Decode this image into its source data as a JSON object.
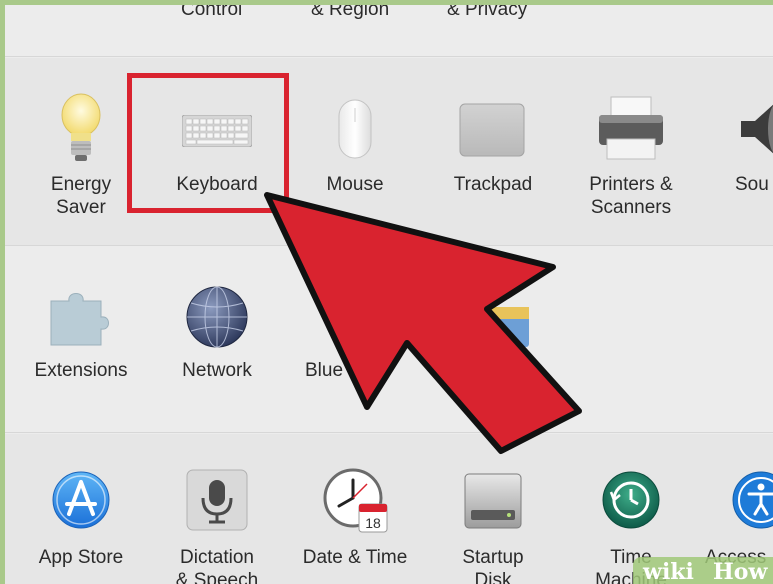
{
  "top_row": {
    "items": [
      "Control",
      "& Region",
      "& Privacy"
    ]
  },
  "row1": {
    "energy_saver": {
      "line1": "Energy",
      "line2": "Saver"
    },
    "keyboard": {
      "line1": "Keyboard"
    },
    "mouse": {
      "line1": "Mouse"
    },
    "trackpad": {
      "line1": "Trackpad"
    },
    "printers": {
      "line1": "Printers &",
      "line2": "Scanners"
    },
    "sound": {
      "line1": "Sou"
    }
  },
  "row2": {
    "extensions": {
      "line1": "Extensions"
    },
    "network": {
      "line1": "Network"
    },
    "bluetooth": {
      "line1": "Blue"
    }
  },
  "row3": {
    "app_store": {
      "line1": "App Store"
    },
    "dictation": {
      "line1": "Dictation",
      "line2": "& Speech"
    },
    "date_time": {
      "line1": "Date & Time",
      "calendar_day": "18"
    },
    "startup_disk": {
      "line1": "Startup",
      "line2": "Disk"
    },
    "time_machine": {
      "line1": "Time",
      "line2": "Machine"
    },
    "accessibility": {
      "line1": "Access"
    }
  },
  "watermark": {
    "wiki": "wiki",
    "how": "How"
  },
  "colors": {
    "highlight": "#d9232f",
    "arrow": "#d9232f",
    "frame": "#a9c98a"
  }
}
